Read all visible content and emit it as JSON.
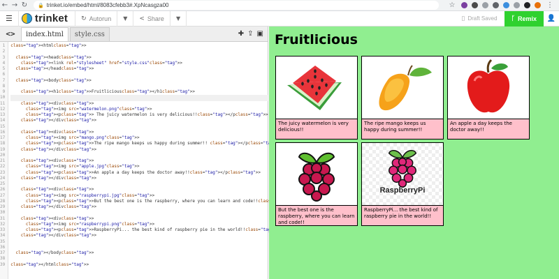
{
  "browser": {
    "url": "trinket.io/embed/html/8083cfebb3#.XpNcasgza00"
  },
  "toolbar": {
    "logo_text": "trinket",
    "autorun_label": "Autorun",
    "share_label": "Share",
    "draft_label": "Draft Saved",
    "remix_label": "Remix"
  },
  "editor": {
    "tabs": [
      {
        "label": "index.html",
        "active": true
      },
      {
        "label": "style.css",
        "active": false
      }
    ],
    "line_numbers": [
      "1",
      "2",
      "3",
      "4",
      "5",
      "6",
      "7",
      "8",
      "9",
      "10",
      "11",
      "12",
      "13",
      "14",
      "15",
      "16",
      "17",
      "18",
      "19",
      "20",
      "21",
      "22",
      "23",
      "24",
      "25",
      "26",
      "27",
      "28",
      "29",
      "30",
      "31",
      "32",
      "33",
      "34",
      "35",
      "36",
      "37",
      "38",
      "39"
    ],
    "lines": [
      "<html>",
      "",
      "  <head>",
      "    <link rel=\"stylesheet\" href=\"style.css\">",
      "  </head>",
      "",
      "  <body>",
      "",
      "    <h1>Fruitlicious</h1>",
      "",
      "    <div>",
      "      <img src=\"watermelon.png\">",
      "      <p> The juicy watermelon is very delicious!!</p>",
      "    </div>",
      "",
      "    <div>",
      "      <img src=\"mango.png\">",
      "      <p>The ripe mango keeps us happy during summer!! </p>",
      "    </div>",
      "",
      "    <div>",
      "      <img src=\"apple.jpg\">",
      "      <p>An apple a day keeps the doctor away!!</p>",
      "    </div>",
      "",
      "    <div>",
      "      <img src=\"raspberrypi.jpg\">",
      "      <p>But the best one is the raspberry, where you can learn and code!!</p>",
      "    </div>",
      "",
      "    <div>",
      "      <img src=\"raspberrypi.png\">",
      "      <p>RaspberryPi... the best kind of raspberry pie in the world!!</p>",
      "    </div>",
      "",
      "",
      "  </body>",
      "",
      "</html>"
    ]
  },
  "preview": {
    "title": "Fruitlicious",
    "cards": [
      {
        "caption": "The juicy watermelon is very delicious!!",
        "image": "watermelon-image"
      },
      {
        "caption": "The ripe mango keeps us happy during summer!!",
        "image": "mango-image"
      },
      {
        "caption": "An apple a day keeps the doctor away!!",
        "image": "apple-image"
      },
      {
        "caption": "But the best one is the raspberry, where you can learn and code!!",
        "image": "raspberry-image"
      },
      {
        "caption": "RaspberryPi... the best kind of raspberry pie in the world!!",
        "image": "raspberrypi-logo-image"
      }
    ],
    "rpi_logo_text": "RaspberryPi",
    "background": "#90ee90",
    "caption_background": "#ffc0cb"
  },
  "colors": {
    "remix": "#2fd12f"
  }
}
